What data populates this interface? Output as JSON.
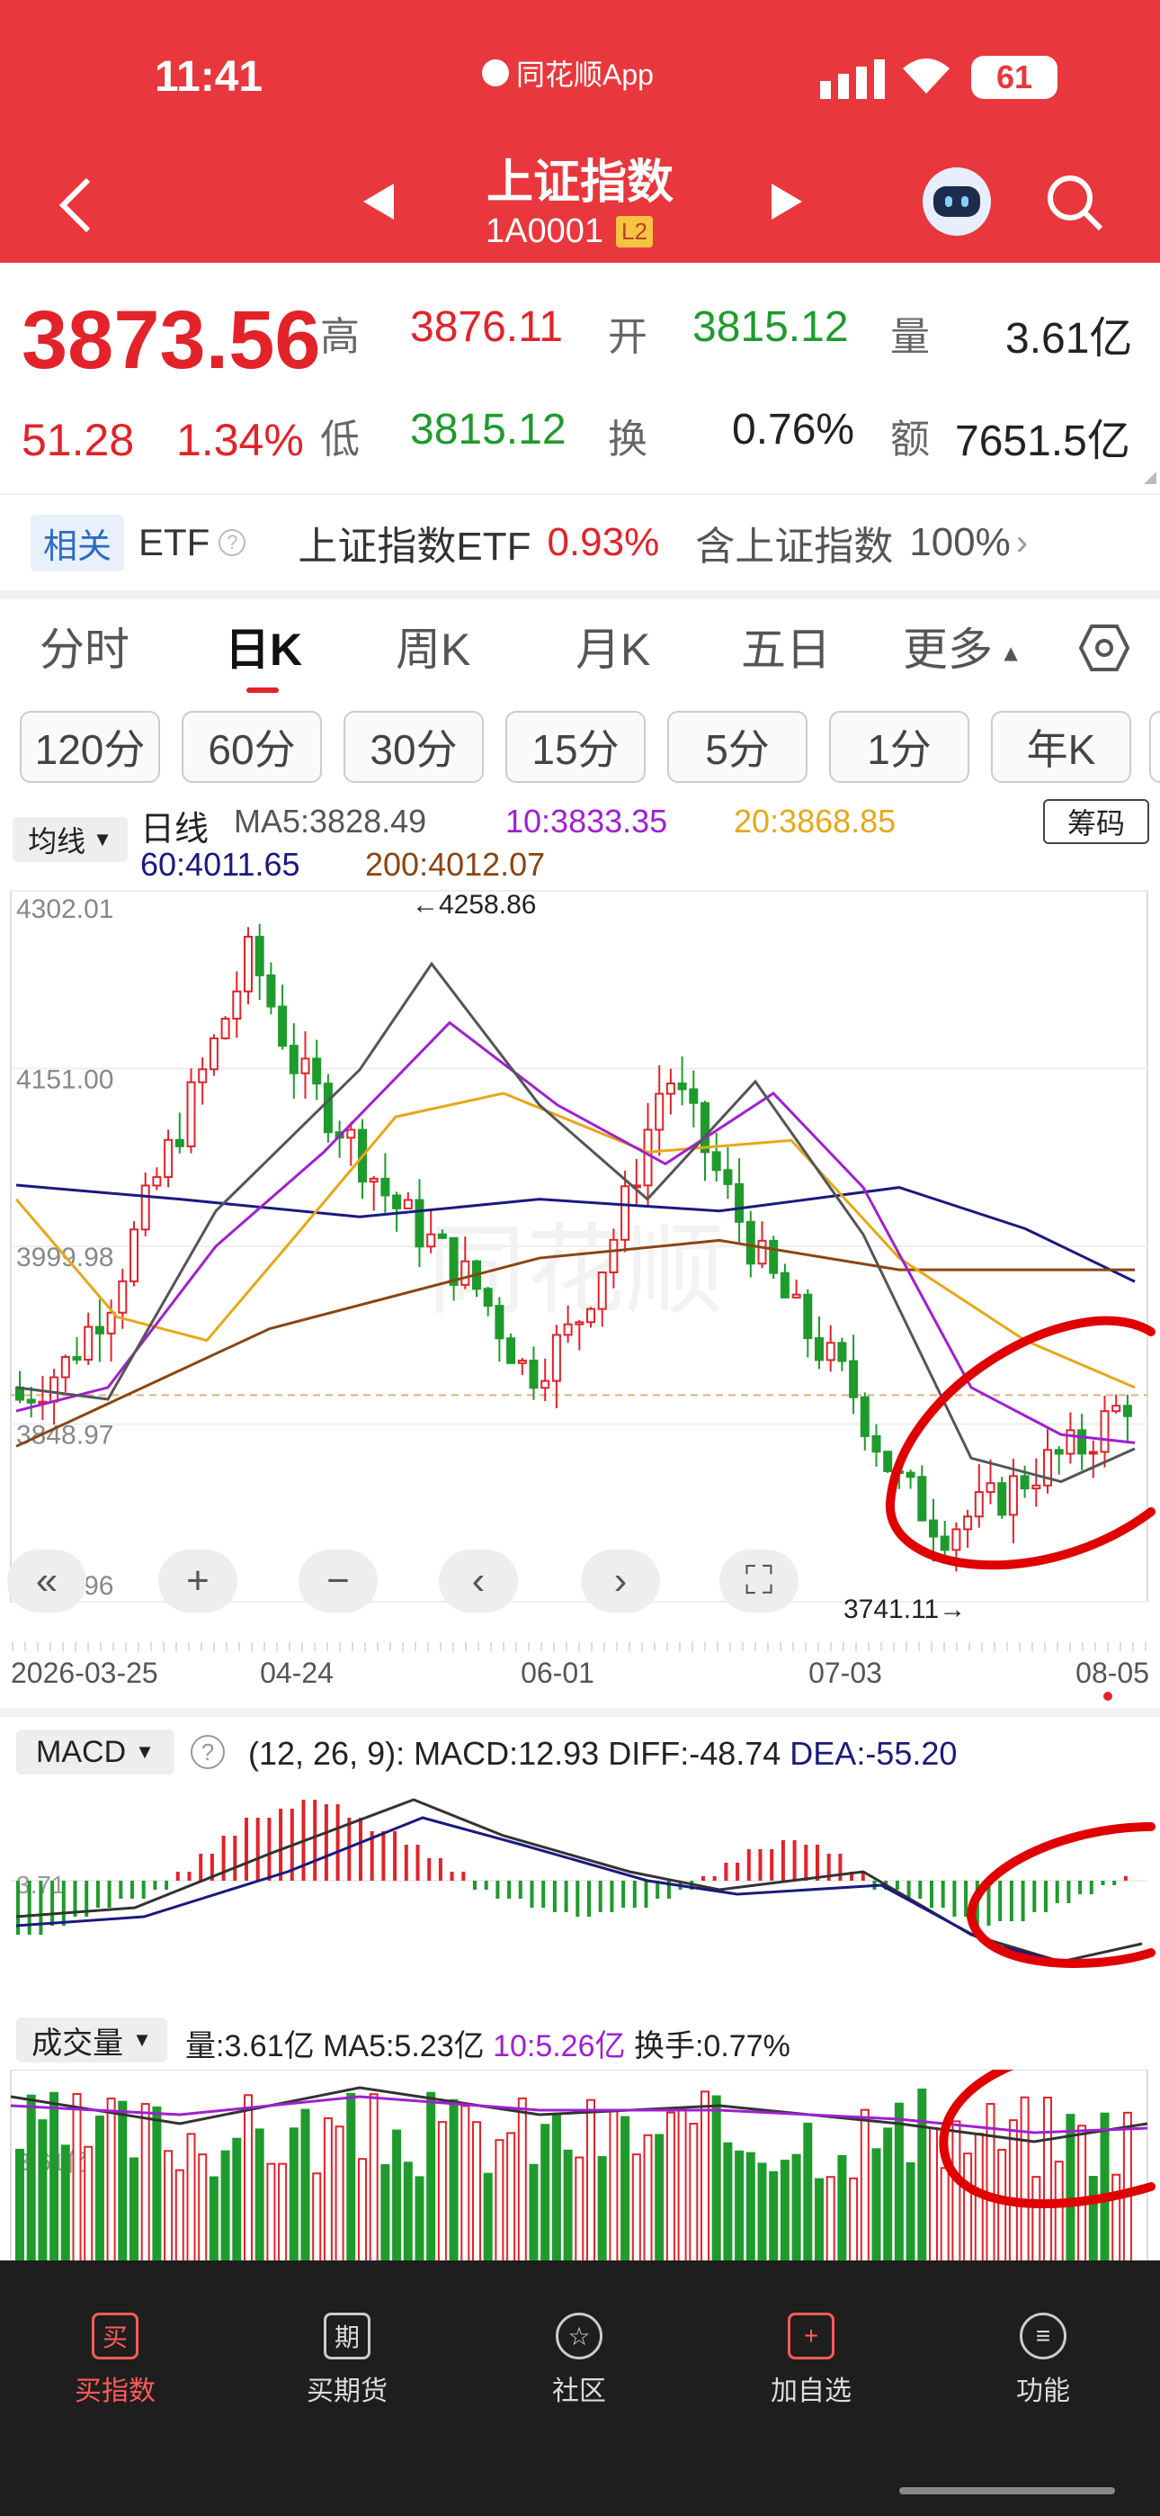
{
  "status_bar": {
    "time": "11:41",
    "app_label": "同花顺App",
    "battery": "61"
  },
  "header": {
    "title": "上证指数",
    "code": "1A0001",
    "badge": "L2"
  },
  "quote": {
    "price": "3873.56",
    "change": "51.28",
    "change_pct": "1.34%",
    "high_label": "高",
    "high": "3876.11",
    "open_label": "开",
    "open": "3815.12",
    "vol_label": "量",
    "vol": "3.61亿",
    "low_label": "低",
    "low": "3815.12",
    "turn_label": "换",
    "turn": "0.76%",
    "amt_label": "额",
    "amt": "7651.5亿"
  },
  "etf": {
    "tag": "相关",
    "label": "ETF",
    "name": "上证指数ETF",
    "pct": "0.93%",
    "contains": "含上证指数",
    "contains_pct": "100%"
  },
  "tabs": [
    "分时",
    "日K",
    "周K",
    "月K",
    "五日",
    "更多"
  ],
  "periods": [
    "120分",
    "60分",
    "30分",
    "15分",
    "5分",
    "1分",
    "年K"
  ],
  "kline": {
    "selector": "均线",
    "line_type": "日线",
    "ma5": "MA5:3828.49",
    "ma10": "10:3833.35",
    "ma20": "20:3868.85",
    "ma60": "60:4011.65",
    "ma200": "200:4012.07",
    "chips_button": "筹码",
    "y_labels": [
      "4302.01",
      "4151.00",
      "3999.98",
      "3848.97",
      "3697.96"
    ],
    "high_mark": "←4258.86",
    "low_mark": "3741.11→",
    "x_labels": [
      "2026-03-25",
      "04-24",
      "06-01",
      "07-03",
      "08-05"
    ],
    "watermark": "同花顺"
  },
  "macd": {
    "selector": "MACD",
    "params": "(12, 26, 9):",
    "macd": "MACD:12.93",
    "diff": "DIFF:-48.74",
    "dea": "DEA:-55.20",
    "axis_label": "3.71"
  },
  "volume": {
    "selector": "成交量",
    "vol": "量:3.61亿",
    "ma5": "MA5:5.23亿",
    "ma10": "10:5.26亿",
    "turnover": "换手:0.77%",
    "axis_label": "3.61亿"
  },
  "bottom_nav": [
    {
      "icon": "买",
      "label": "买指数"
    },
    {
      "icon": "期",
      "label": "买期货"
    },
    {
      "icon": "☆",
      "label": "社区"
    },
    {
      "icon": "+",
      "label": "加自选"
    },
    {
      "icon": "≡",
      "label": "功能"
    }
  ],
  "colors": {
    "header": "#e8383d",
    "up": "#e2232a",
    "down": "#1e9b2c",
    "ma5": "#555555",
    "ma10": "#a020d0",
    "ma20": "#e6a817",
    "ma60": "#1a1a80",
    "ma200": "#8b4513",
    "annotation": "#e00000"
  }
}
